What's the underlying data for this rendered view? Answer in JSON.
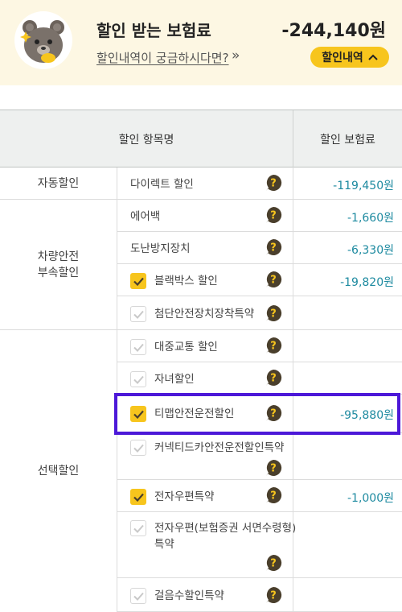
{
  "header": {
    "title": "할인 받는 보험료",
    "amount": "-244,140원",
    "link": "할인내역이 궁금하시다면?",
    "link_arrow": "»",
    "button": "할인내역",
    "icon": "bear-avatar"
  },
  "table": {
    "headers": {
      "name": "할인 항목명",
      "amount": "할인 보험료"
    },
    "categories": {
      "auto": "자동할인",
      "vehicle": "차량안전\n부속할인",
      "optional": "선택할인"
    },
    "rows": [
      {
        "label": "다이렉트 할인",
        "amount": "-119,450원",
        "checkbox": "none"
      },
      {
        "label": "에어백",
        "amount": "-1,660원",
        "checkbox": "none"
      },
      {
        "label": "도난방지장치",
        "amount": "-6,330원",
        "checkbox": "none"
      },
      {
        "label": "블랙박스 할인",
        "amount": "-19,820원",
        "checkbox": "checked"
      },
      {
        "label": "첨단안전장치장착특약",
        "amount": "",
        "checkbox": "unchecked"
      },
      {
        "label": "대중교통 할인",
        "amount": "",
        "checkbox": "unchecked"
      },
      {
        "label": "자녀할인",
        "amount": "",
        "checkbox": "unchecked"
      },
      {
        "label": "티맵안전운전할인",
        "amount": "-95,880원",
        "checkbox": "checked"
      },
      {
        "label": "커넥티드카안전운전할인특약",
        "amount": "",
        "checkbox": "unchecked"
      },
      {
        "label": "전자우편특약",
        "amount": "-1,000원",
        "checkbox": "checked"
      },
      {
        "label": "전자우편(보험증권 서면수령형)",
        "label2": "특약",
        "amount": "",
        "checkbox": "unchecked"
      },
      {
        "label": "걸음수할인특약",
        "amount": "",
        "checkbox": "unchecked"
      }
    ]
  },
  "colors": {
    "header_bg": "#fdf7e3",
    "accent": "#f7c51d",
    "amount": "#1d8aa0",
    "highlight": "#4c18d8",
    "help_icon": "#4a3f2c"
  }
}
